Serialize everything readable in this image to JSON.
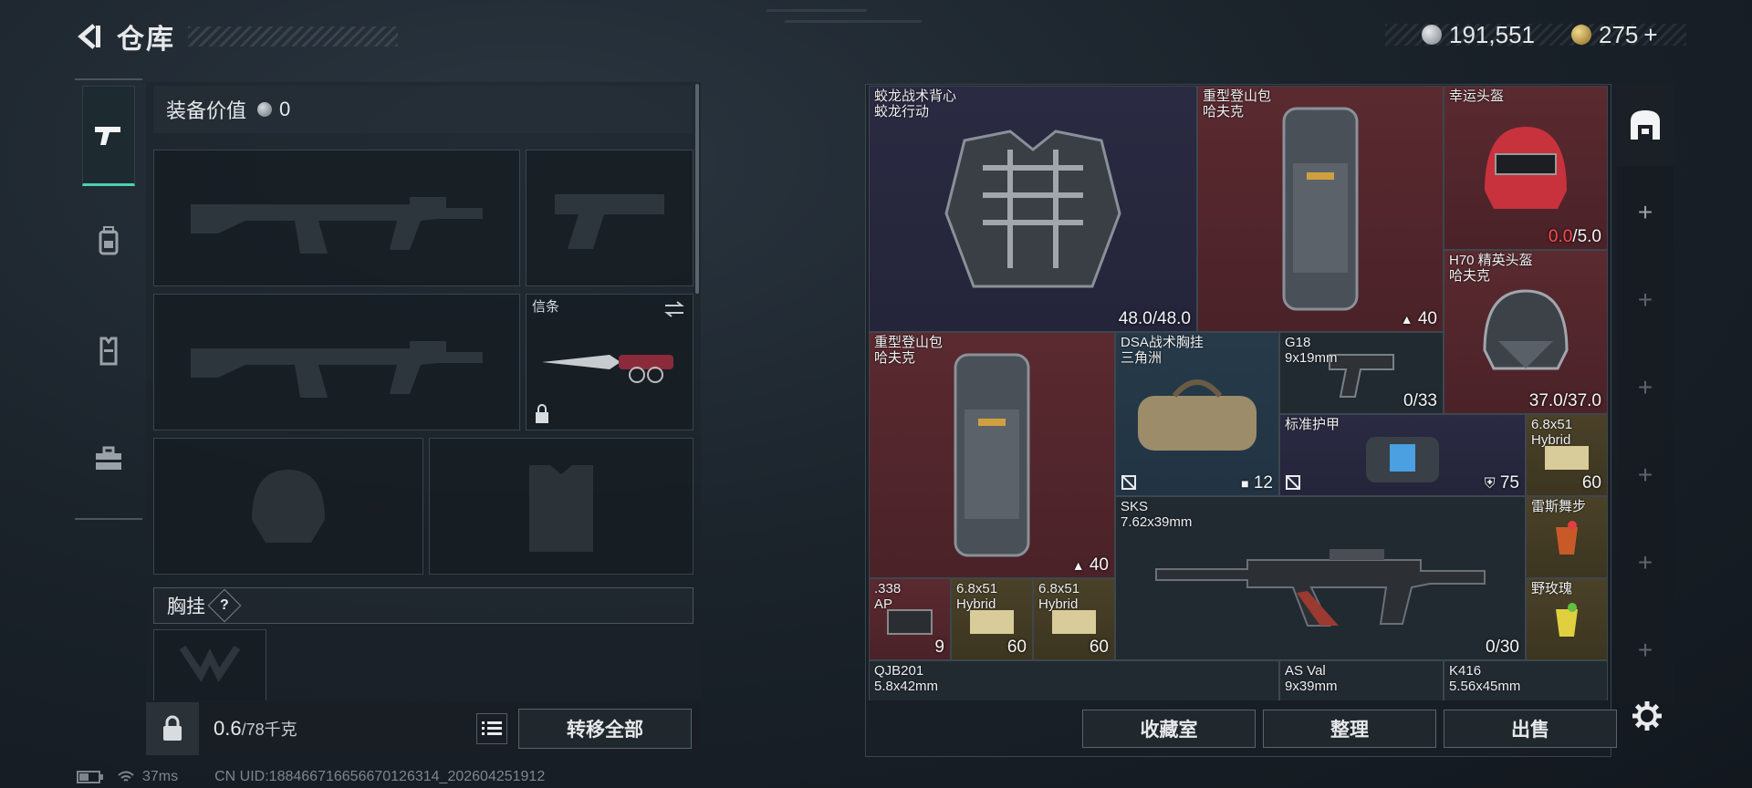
{
  "header": {
    "title": "仓库"
  },
  "currency": [
    {
      "icon": "silver-coin-icon",
      "value": "191,551"
    },
    {
      "icon": "gold-coin-icon",
      "value": "275",
      "plus": "+"
    }
  ],
  "left_tabs": [
    {
      "icon": "pistol-icon",
      "active": true
    },
    {
      "icon": "backpack-icon",
      "active": false
    },
    {
      "icon": "vest-icon",
      "active": false
    },
    {
      "icon": "toolbox-icon",
      "active": false
    }
  ],
  "equipment": {
    "value_label": "装备价值",
    "value": "0",
    "melee_label": "信条",
    "chest_rig_label": "胸挂",
    "help": "?"
  },
  "bottom_left": {
    "weight_current": "0.6",
    "weight_max": "/78千克",
    "transfer_all": "转移全部"
  },
  "status": {
    "ping": "37ms",
    "uid": "CN UID:18846671665667012631​4_202604251912"
  },
  "stash_items": [
    {
      "name1": "蛟龙战术背心",
      "name2": "蛟龙行动",
      "value": "48.0/48.0",
      "color": "purple"
    },
    {
      "name1": "重型登山包",
      "name2": "哈夫克",
      "value": "40",
      "color": "red"
    },
    {
      "name1": "幸运头盔",
      "name2": "",
      "dur_current": "0.0",
      "dur_max": "/5.0",
      "color": "red"
    },
    {
      "name1": "H70 精英头盔",
      "name2": "哈夫克",
      "value": "37.0/37.0",
      "color": "red"
    },
    {
      "name1": "重型登山包",
      "name2": "哈夫克",
      "value": "40",
      "color": "red"
    },
    {
      "name1": "DSA战术胸挂",
      "name2": "三角洲",
      "value": "12",
      "color": "blue"
    },
    {
      "name1": "G18",
      "name2": "9x19mm",
      "value": "0/33",
      "color": "grey"
    },
    {
      "name1": "标准护甲",
      "name2": "",
      "value": "75",
      "color": "purple"
    },
    {
      "name1": "6.8x51",
      "name2": "Hybrid",
      "value": "60",
      "color": "gold"
    },
    {
      "name1": "SKS",
      "name2": "7.62x39mm",
      "value": "0/30",
      "color": "grey"
    },
    {
      "name1": "雷斯舞步",
      "name2": "",
      "value": "",
      "color": "gold"
    },
    {
      "name1": "野玫瑰",
      "name2": "",
      "value": "",
      "color": "gold"
    },
    {
      "name1": ".338",
      "name2": "AP",
      "value": "9",
      "color": "red"
    },
    {
      "name1": "6.8x51",
      "name2": "Hybrid",
      "value": "60",
      "color": "gold"
    },
    {
      "name1": "6.8x51",
      "name2": "Hybrid",
      "value": "60",
      "color": "gold"
    },
    {
      "name1": "QJB201",
      "name2": "5.8x42mm",
      "value": "",
      "color": "grey"
    },
    {
      "name1": "AS Val",
      "name2": "9x39mm",
      "value": "",
      "color": "grey"
    },
    {
      "name1": "K416",
      "name2": "5.56x45mm",
      "value": "",
      "color": "grey"
    }
  ],
  "actions": {
    "collection": "收藏室",
    "sort": "整理",
    "sell": "出售"
  },
  "right_rail": {
    "add": "+"
  }
}
